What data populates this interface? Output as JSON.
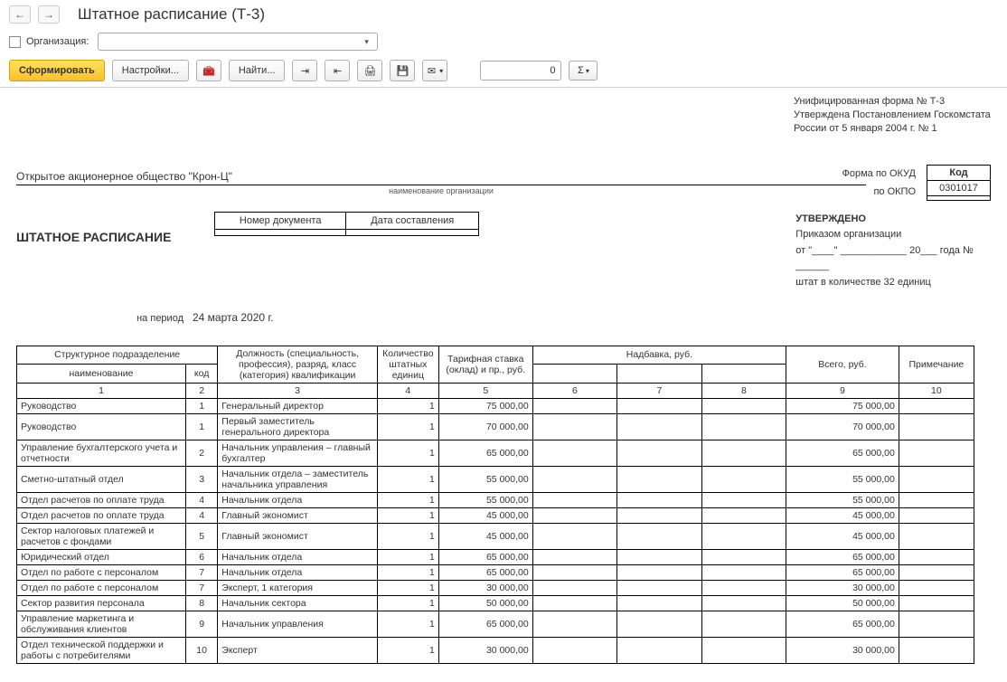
{
  "header": {
    "title": "Штатное расписание (Т-3)",
    "org_label": "Организация:",
    "org_value": ""
  },
  "toolbar": {
    "generate": "Сформировать",
    "settings": "Настройки...",
    "find": "Найти...",
    "num_value": "0"
  },
  "form_meta": {
    "line1": "Унифицированная форма № Т-3",
    "line2": "Утверждена Постановлением Госкомстата",
    "line3": "России от 5 января 2004 г. № 1"
  },
  "codes": {
    "code_header": "Код",
    "okud_label": "Форма по ОКУД",
    "okud": "0301017",
    "okpo_label": "по ОКПО",
    "okpo": ""
  },
  "org": {
    "name": "Открытое акционерное общество \"Крон-Ц\"",
    "sub": "наименование организации"
  },
  "doc": {
    "title": "ШТАТНОЕ РАСПИСАНИЕ",
    "num_header": "Номер документа",
    "date_header": "Дата составления",
    "num_value": "",
    "date_value": ""
  },
  "approved": {
    "header": "УТВЕРЖДЕНО",
    "line1_a": "Приказом организации",
    "line2": "от \"____\" ____________ 20___ года № ______",
    "line3": "штат в количестве 32 единиц"
  },
  "period": {
    "label": "на период",
    "value": "24 марта 2020 г."
  },
  "table": {
    "headers": {
      "struct": "Структурное подразделение",
      "name": "наименование",
      "code": "код",
      "position": "Должность (специальность, профессия), разряд, класс (категория) квалификации",
      "qty": "Количество штатных единиц",
      "rate": "Тарифная ставка (оклад) и пр., руб.",
      "addition": "Надбавка, руб.",
      "total": "Всего, руб.",
      "note": "Примечание"
    },
    "colnums": [
      "1",
      "2",
      "3",
      "4",
      "5",
      "6",
      "7",
      "8",
      "9",
      "10"
    ],
    "rows": [
      {
        "name": "Руководство",
        "code": "1",
        "pos": "Генеральный директор",
        "qty": "1",
        "rate": "75 000,00",
        "total": "75 000,00"
      },
      {
        "name": "Руководство",
        "code": "1",
        "pos": "Первый заместитель генерального директора",
        "qty": "1",
        "rate": "70 000,00",
        "total": "70 000,00"
      },
      {
        "name": "Управление бухгалтерского учета и отчетности",
        "code": "2",
        "pos": "Начальник управления – главный бухгалтер",
        "qty": "1",
        "rate": "65 000,00",
        "total": "65 000,00"
      },
      {
        "name": "Сметно-штатный отдел",
        "code": "3",
        "pos": "Начальник отдела – заместитель начальника управления",
        "qty": "1",
        "rate": "55 000,00",
        "total": "55 000,00"
      },
      {
        "name": "Отдел расчетов по оплате труда",
        "code": "4",
        "pos": "Начальник отдела",
        "qty": "1",
        "rate": "55 000,00",
        "total": "55 000,00"
      },
      {
        "name": "Отдел расчетов по оплате труда",
        "code": "4",
        "pos": "Главный экономист",
        "qty": "1",
        "rate": "45 000,00",
        "total": "45 000,00"
      },
      {
        "name": "Сектор налоговых платежей и расчетов с фондами",
        "code": "5",
        "pos": "Главный экономист",
        "qty": "1",
        "rate": "45 000,00",
        "total": "45 000,00"
      },
      {
        "name": "Юридический отдел",
        "code": "6",
        "pos": "Начальник отдела",
        "qty": "1",
        "rate": "65 000,00",
        "total": "65 000,00"
      },
      {
        "name": "Отдел по работе с персоналом",
        "code": "7",
        "pos": "Начальник отдела",
        "qty": "1",
        "rate": "65 000,00",
        "total": "65 000,00"
      },
      {
        "name": "Отдел по работе с персоналом",
        "code": "7",
        "pos": "Эксперт, 1 категория",
        "qty": "1",
        "rate": "30 000,00",
        "total": "30 000,00"
      },
      {
        "name": "Сектор развития персонала",
        "code": "8",
        "pos": "Начальник сектора",
        "qty": "1",
        "rate": "50 000,00",
        "total": "50 000,00"
      },
      {
        "name": "Управление маркетинга и обслуживания клиентов",
        "code": "9",
        "pos": "Начальник управления",
        "qty": "1",
        "rate": "65 000,00",
        "total": "65 000,00"
      },
      {
        "name": "Отдел технической поддержки и работы с потребителями",
        "code": "10",
        "pos": "Эксперт",
        "qty": "1",
        "rate": "30 000,00",
        "total": "30 000,00"
      }
    ]
  }
}
